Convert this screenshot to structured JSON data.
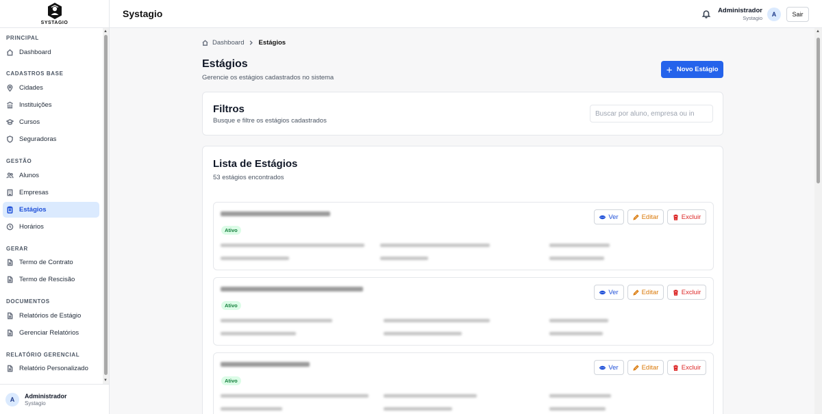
{
  "brand": {
    "logo_text": "SYSTAGIO",
    "app_title": "Systagio"
  },
  "sidebar": {
    "sections": [
      {
        "title": "PRINCIPAL",
        "items": [
          {
            "label": "Dashboard",
            "icon": "home-icon"
          }
        ]
      },
      {
        "title": "CADASTROS BASE",
        "items": [
          {
            "label": "Cidades",
            "icon": "map-pin-icon"
          },
          {
            "label": "Instituições",
            "icon": "building-icon"
          },
          {
            "label": "Cursos",
            "icon": "graduation-cap-icon"
          },
          {
            "label": "Seguradoras",
            "icon": "shield-icon"
          }
        ]
      },
      {
        "title": "GESTÃO",
        "items": [
          {
            "label": "Alunos",
            "icon": "users-icon"
          },
          {
            "label": "Empresas",
            "icon": "office-icon"
          },
          {
            "label": "Estágios",
            "icon": "clipboard-icon",
            "active": true
          },
          {
            "label": "Horários",
            "icon": "clock-icon"
          }
        ]
      },
      {
        "title": "GERAR",
        "items": [
          {
            "label": "Termo de Contrato",
            "icon": "file-icon"
          },
          {
            "label": "Termo de Rescisão",
            "icon": "file-icon"
          }
        ]
      },
      {
        "title": "DOCUMENTOS",
        "items": [
          {
            "label": "Relatórios de Estágio",
            "icon": "file-icon"
          },
          {
            "label": "Gerenciar Relatórios",
            "icon": "file-icon"
          }
        ]
      },
      {
        "title": "RELATÓRIO GERENCIAL",
        "items": [
          {
            "label": "Relatório Personalizado",
            "icon": "file-icon"
          }
        ]
      }
    ],
    "footer": {
      "avatar": "A",
      "name": "Administrador",
      "org": "Systagio"
    }
  },
  "header": {
    "user_name": "Administrador",
    "user_org": "Systagio",
    "avatar": "A",
    "logout_label": "Sair"
  },
  "breadcrumb": {
    "home": "Dashboard",
    "current": "Estágios"
  },
  "page": {
    "title": "Estágios",
    "subtitle": "Gerencie os estágios cadastrados no sistema",
    "new_button": "Novo Estágio"
  },
  "filters": {
    "title": "Filtros",
    "subtitle": "Busque e filtre os estágios cadastrados",
    "search_placeholder": "Buscar por aluno, empresa ou in"
  },
  "list": {
    "title": "Lista de Estágios",
    "count_text": "53 estágios encontrados",
    "items": [
      {
        "status": "Ativo",
        "view": "Ver",
        "edit": "Editar",
        "delete": "Excluir"
      },
      {
        "status": "Ativo",
        "view": "Ver",
        "edit": "Editar",
        "delete": "Excluir"
      },
      {
        "status": "Ativo",
        "view": "Ver",
        "edit": "Editar",
        "delete": "Excluir"
      }
    ]
  },
  "colors": {
    "primary": "#2563eb",
    "active_bg": "#dbeafe",
    "status_bg": "#dcfce7",
    "status_text": "#15803d",
    "edit": "#d97706",
    "delete": "#dc2626"
  }
}
